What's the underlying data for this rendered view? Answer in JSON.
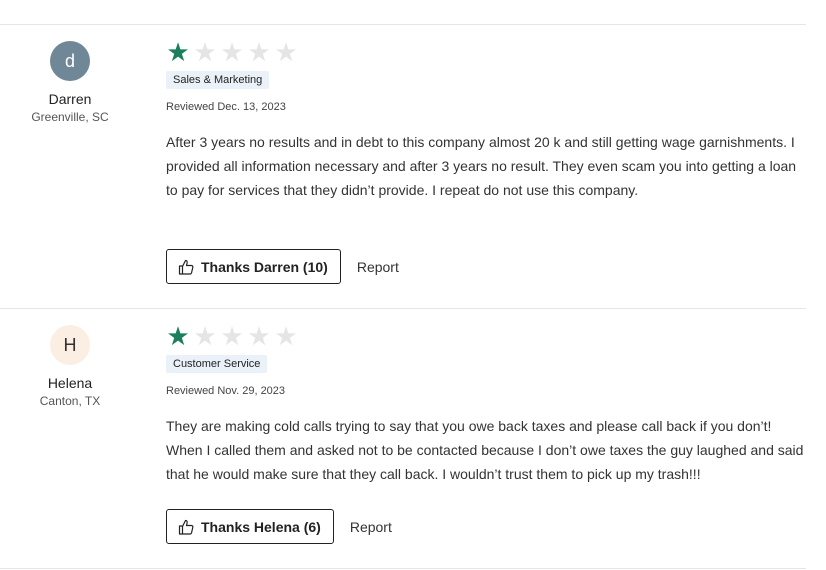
{
  "reviews": [
    {
      "avatar_letter": "d",
      "avatar_bg": "#6f8796",
      "avatar_fg": "#ffffff",
      "user_name": "Darren",
      "user_location": "Greenville, SC",
      "rating": 1,
      "max_rating": 5,
      "category": "Sales & Marketing",
      "date": "Reviewed Dec. 13, 2023",
      "text": "After 3 years no results and in debt to this company almost 20 k and still getting wage garnishments. I provided all information necessary and after 3 years no result. They even scam you into getting a loan to pay for services that they didn’t provide. I repeat do not use this company.",
      "thanks_label": "Thanks Darren (10)",
      "report_label": "Report"
    },
    {
      "avatar_letter": "H",
      "avatar_bg": "#fbeee3",
      "avatar_fg": "#333333",
      "user_name": "Helena",
      "user_location": "Canton, TX",
      "rating": 1,
      "max_rating": 5,
      "category": "Customer Service",
      "date": "Reviewed Nov. 29, 2023",
      "text": "They are making cold calls trying to say that you owe back taxes and please call back if you don’t! When I called them and asked not to be contacted because I don’t owe taxes the guy laughed and said that he would make sure that they call back. I wouldn’t trust them to pick up my trash!!!",
      "thanks_label": "Thanks Helena (6)",
      "report_label": "Report"
    }
  ],
  "colors": {
    "star_on": "#1a7f5a",
    "star_off": "#e5e5e5",
    "tag_bg": "#eaf1f8"
  },
  "icons": {
    "rating": "star-icon",
    "thanks": "thumbs-up-icon"
  }
}
